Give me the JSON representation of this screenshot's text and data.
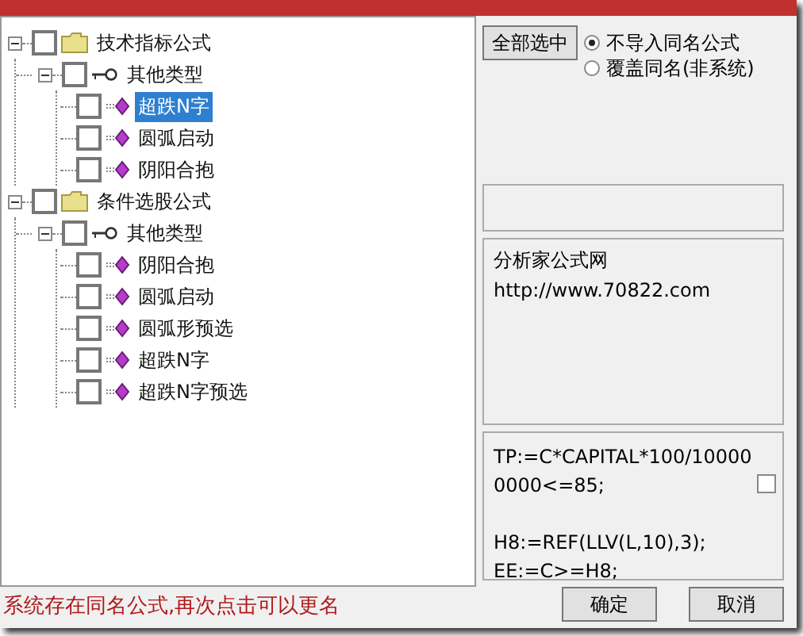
{
  "tree": [
    {
      "label": "技术指标公式",
      "kind": "group",
      "expanded": true,
      "checked": false,
      "children": [
        {
          "label": "其他类型",
          "kind": "type",
          "expanded": true,
          "checked": false,
          "children": [
            {
              "label": "超跌N字",
              "kind": "formula",
              "checked": false,
              "selected": true
            },
            {
              "label": "圆弧启动",
              "kind": "formula",
              "checked": false,
              "selected": false
            },
            {
              "label": "阴阳合抱",
              "kind": "formula",
              "checked": false,
              "selected": false
            }
          ]
        }
      ]
    },
    {
      "label": "条件选股公式",
      "kind": "group",
      "expanded": true,
      "checked": false,
      "children": [
        {
          "label": "其他类型",
          "kind": "type",
          "expanded": true,
          "checked": false,
          "children": [
            {
              "label": "阴阳合抱",
              "kind": "formula",
              "checked": false,
              "selected": false
            },
            {
              "label": "圆弧启动",
              "kind": "formula",
              "checked": false,
              "selected": false
            },
            {
              "label": "圆弧形预选",
              "kind": "formula",
              "checked": false,
              "selected": false
            },
            {
              "label": "超跌N字",
              "kind": "formula",
              "checked": false,
              "selected": false
            },
            {
              "label": "超跌N字预选",
              "kind": "formula",
              "checked": false,
              "selected": false
            }
          ]
        }
      ]
    }
  ],
  "select_all_button": "全部选中",
  "import_options": [
    {
      "label": "不导入同名公式",
      "selected": true
    },
    {
      "label": "覆盖同名(非系统)",
      "selected": false
    }
  ],
  "info_text": [
    "分析家公式网",
    "http://www.70822.com"
  ],
  "formula_text": [
    "TP:=C*CAPITAL*100/100000000<=85;",
    "H8:=REF(LLV(L,10),3);",
    "EE:=C>=H8;"
  ],
  "formula_checkbox": {
    "checked": false
  },
  "status_message": "系统存在同名公式,再次点击可以更名",
  "buttons": [
    "确定",
    "取消"
  ]
}
